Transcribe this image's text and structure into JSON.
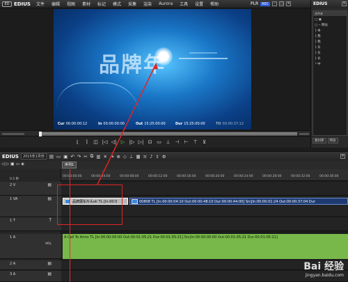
{
  "menubar": {
    "logo": "ED",
    "app": "EDIUS",
    "items": [
      "文件",
      "编辑",
      "视图",
      "素材",
      "标记",
      "模式",
      "采集",
      "渲染",
      "Aurora",
      "工具",
      "设置",
      "帮助"
    ],
    "plr": "PLR",
    "rec": "REC"
  },
  "bin": {
    "title": "EDIUS",
    "header": "文件夹",
    "tree": [
      "□ ▣",
      "□ ─ 网站",
      "  ├ 本",
      "  ├ 我",
      "  ├ 我",
      "  ├ 东",
      "  ├ 东",
      "  ├ 长",
      "  └ 中"
    ],
    "tabs": [
      "素材库",
      "特效"
    ]
  },
  "preview": {
    "brand_text": "品牌年",
    "timecodes": [
      {
        "label": "Cur",
        "value": "00:00:00:12"
      },
      {
        "label": "In",
        "value": "00:00:00:00"
      },
      {
        "label": "Out",
        "value": "15:25:00:00"
      },
      {
        "label": "Dur",
        "value": "15:25:00:00"
      },
      {
        "label": "Ttl",
        "value": "00:00:37:12"
      }
    ]
  },
  "transport": [
    "⌊",
    "⌉",
    "◫",
    "|◁",
    "◁|",
    "▷",
    "|▷",
    "▷|",
    "⊡",
    "▭",
    "⊥",
    "⊣",
    "⊢",
    "⊤",
    "⊻"
  ],
  "timeline": {
    "app": "EDIUS",
    "project": "2015年1月份",
    "sequence_tab": "序列1",
    "zoom": "0.5 秒",
    "ruler_ticks": [
      "00:00:00:00",
      "00:00:04:00",
      "00:00:08:00",
      "00:00:12:00",
      "00:00:16:00",
      "00:00:20:00",
      "00:00:24:00",
      "00:00:28:00",
      "00:00:32:00",
      "00:00:36:00"
    ]
  },
  "tracks": [
    {
      "name": "2 V",
      "icon": "▤"
    },
    {
      "name": "1 VA",
      "icon": "▤"
    },
    {
      "name": "1 T",
      "icon": "T"
    },
    {
      "name": "1 A",
      "icon": "VOL"
    },
    {
      "name": "2 A",
      "icon": "▤"
    },
    {
      "name": "3 A",
      "icon": "▤"
    }
  ],
  "clips": {
    "video_highlight": "品牌展车片头ok  TL [In:00:0",
    "video_info": "00808  TL [In:00:00:04:10 Out:00:00:48:10 Dur:00:00:44:00]  Src[In:00:00:01:24 Out:00:00:37:04 Dur",
    "audio": "A Call To Arms  TL [In:00:00:00:00 Out:00:01:05:21 Dur:00:01:05:21]  Src[In:00:00:00:00 Out:00:01:05:21 Dur:00:01:05:21]"
  },
  "watermark": {
    "main": "Bai 经验",
    "sub": "jingyan.baidu.com"
  },
  "colors": {
    "annotation": "#e02424",
    "play": "#62d24d",
    "audio_clip": "#78b84a",
    "rec_badge": "#2a5bd7"
  }
}
